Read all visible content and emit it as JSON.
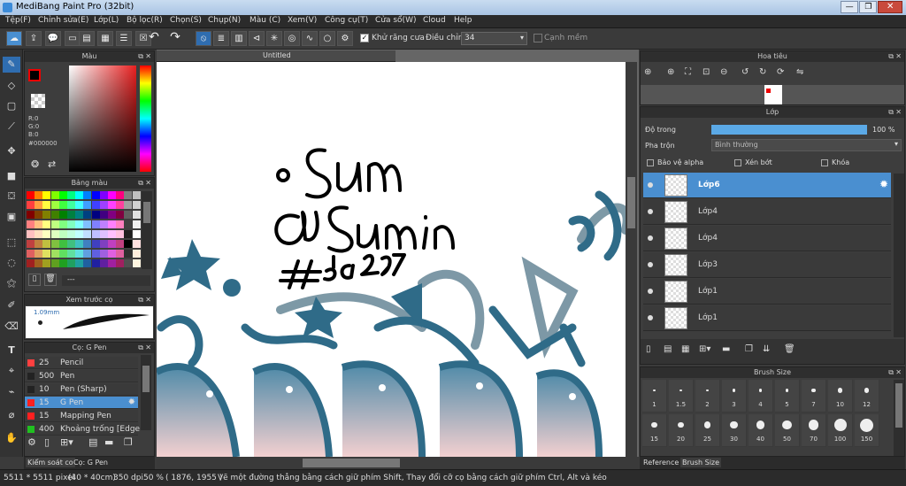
{
  "app": {
    "title": "MediBang Paint Pro (32bit)"
  },
  "menu": [
    "Tệp(F)",
    "Chỉnh sửa(E)",
    "Lớp(L)",
    "Bộ lọc(R)",
    "Chọn(S)",
    "Chụp(N)",
    "Màu (C)",
    "Xem(V)",
    "Công cụ(T)",
    "Cửa sổ(W)",
    "Cloud",
    "Help"
  ],
  "toolbar": {
    "antialias_label": "Khử răng cưa",
    "adjust_label": "Điều chỉnh",
    "adjust_value": "34",
    "edge_label": "Cạnh mềm"
  },
  "color_panel": {
    "title": "Màu",
    "r": "R:0",
    "g": "G:0",
    "b": "B:0",
    "hex": "#000000"
  },
  "palette_panel": {
    "title": "Bảng màu",
    "footer_label": "---",
    "colors": [
      "#ff0000",
      "#ff8000",
      "#ffff00",
      "#80ff00",
      "#00ff00",
      "#00ff80",
      "#00ffff",
      "#0080ff",
      "#0000ff",
      "#8000ff",
      "#ff00ff",
      "#ff0080",
      "#808080",
      "#c0c0c0",
      "#ff4040",
      "#ff9f40",
      "#ffff40",
      "#9fff40",
      "#40ff40",
      "#40ff9f",
      "#40ffff",
      "#409fff",
      "#4040ff",
      "#9f40ff",
      "#ff40ff",
      "#ff409f",
      "#a0a0a0",
      "#d0d0d0",
      "#800000",
      "#804000",
      "#808000",
      "#408000",
      "#008000",
      "#008040",
      "#008080",
      "#004080",
      "#000080",
      "#400080",
      "#800080",
      "#800040",
      "#606060",
      "#e0e0e0",
      "#ff8080",
      "#ffbf80",
      "#ffff80",
      "#bfff80",
      "#80ff80",
      "#80ffbf",
      "#80ffff",
      "#80bfff",
      "#8080ff",
      "#bf80ff",
      "#ff80ff",
      "#ff80bf",
      "#404040",
      "#f0f0f0",
      "#ffc0c0",
      "#ffdfc0",
      "#ffffc0",
      "#dfffc0",
      "#c0ffc0",
      "#c0ffdf",
      "#c0ffff",
      "#c0dfff",
      "#c0c0ff",
      "#dfc0ff",
      "#ffc0ff",
      "#ffc0df",
      "#202020",
      "#ffffff",
      "#c04040",
      "#c08040",
      "#c0c040",
      "#80c040",
      "#40c040",
      "#40c080",
      "#40c0c0",
      "#4080c0",
      "#4040c0",
      "#8040c0",
      "#c040c0",
      "#c04080",
      "#000000",
      "#ffe0e0",
      "#e06060",
      "#e0a060",
      "#e0e060",
      "#a0e060",
      "#60e060",
      "#60e0a0",
      "#60e0e0",
      "#60a0e0",
      "#6060e0",
      "#a060e0",
      "#e060e0",
      "#e060a0",
      "#303030",
      "#ffeedd",
      "#a02020",
      "#a06020",
      "#a0a020",
      "#60a020",
      "#20a020",
      "#20a060",
      "#20a0a0",
      "#2060a0",
      "#2020a0",
      "#6020a0",
      "#a020a0",
      "#a02060",
      "#505050",
      "#fff5e0"
    ]
  },
  "preview_panel": {
    "title": "Xem trước cọ",
    "size_label": "1.09mm"
  },
  "brush_panel": {
    "title": "Cọ: G Pen",
    "brushes": [
      {
        "size": "25",
        "name": "Pencil",
        "color": "#ff4040"
      },
      {
        "size": "500",
        "name": "Pen",
        "color": "#222222"
      },
      {
        "size": "10",
        "name": "Pen (Sharp)",
        "color": "#222222"
      },
      {
        "size": "15",
        "name": "G Pen",
        "color": "#ff2020"
      },
      {
        "size": "15",
        "name": "Mapping Pen",
        "color": "#ff2020"
      },
      {
        "size": "400",
        "name": "Khoảng trống [Edge",
        "color": "#20c020"
      }
    ]
  },
  "left_tabs": [
    "Kiểm soát co",
    "Cọ: G Pen"
  ],
  "canvas": {
    "tab_title": "Untitled"
  },
  "navigator_panel": {
    "title": "Hoa tiêu"
  },
  "layer_panel": {
    "title": "Lớp",
    "opacity_label": "Độ trong",
    "opacity_value": "100 %",
    "opacity_fraction": 1.0,
    "blend_label": "Pha trộn",
    "blend_value": "Bình thường",
    "protect_alpha": "Bảo vệ alpha",
    "clip": "Xén bớt",
    "lock": "Khóa",
    "layers": [
      "Lớp6",
      "Lớp4",
      "Lớp4",
      "Lớp3",
      "Lớp1",
      "Lớp1"
    ]
  },
  "brushsize_panel": {
    "title": "Brush Size",
    "sizes": [
      "1",
      "1.5",
      "2",
      "3",
      "4",
      "5",
      "7",
      "10",
      "12",
      "15",
      "20",
      "25",
      "30",
      "40",
      "50",
      "70",
      "100",
      "150"
    ]
  },
  "right_tabs": [
    "Reference",
    "Brush Size"
  ],
  "status": {
    "dimensions": "5511 * 5511 pixel",
    "size_cm": "(40 * 40cm)",
    "dpi": "350 dpi",
    "zoom": "50 %",
    "coords": "( 1876, 1955 )",
    "hint": "Vẽ một đường thẳng bằng cách giữ phím Shift, Thay đổi cỡ cọ bằng cách giữ phím Ctrl, Alt và kéo"
  }
}
